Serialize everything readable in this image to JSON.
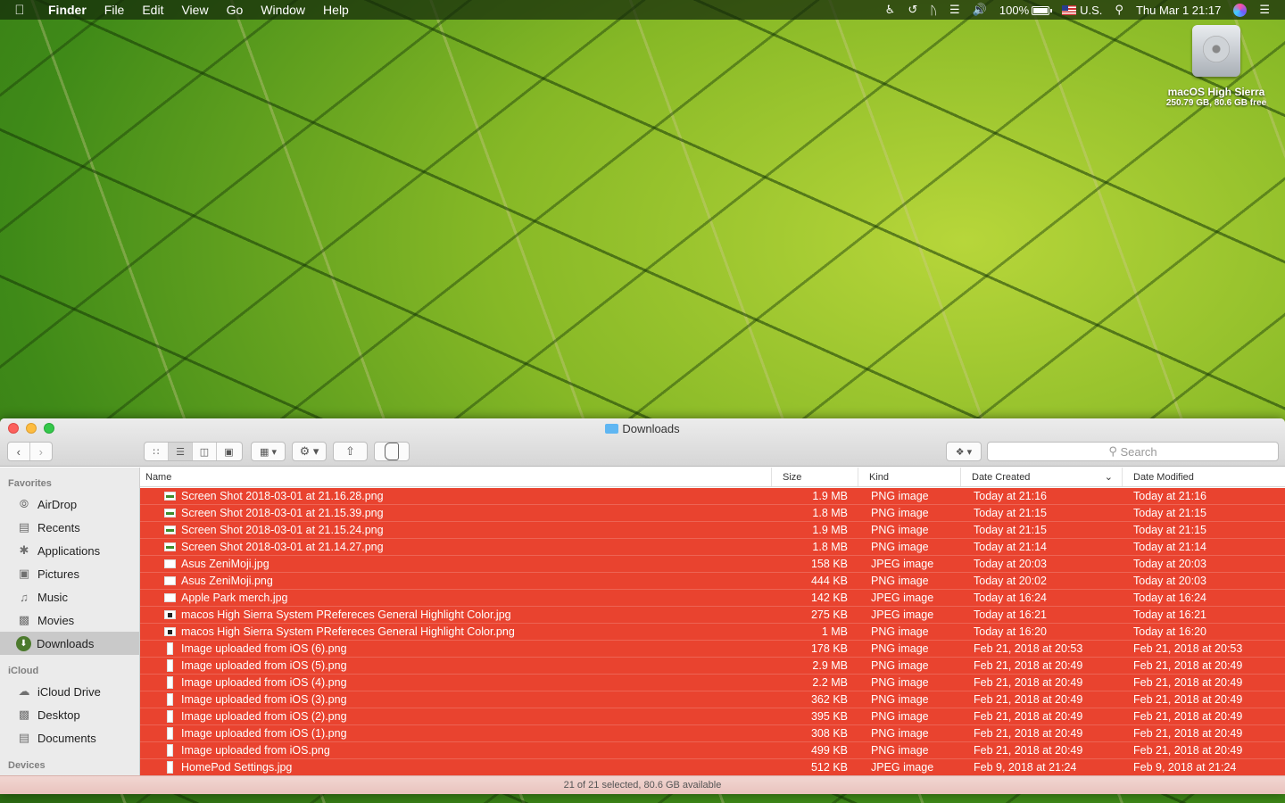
{
  "menubar": {
    "apple": "",
    "app_name": "Finder",
    "menus": [
      "File",
      "Edit",
      "View",
      "Go",
      "Window",
      "Help"
    ],
    "battery": "100%",
    "input_source": "U.S.",
    "datetime": "Thu Mar 1  21:17"
  },
  "desktop": {
    "drive_name": "macOS High Sierra",
    "drive_info": "250.79 GB, 80.6 GB free"
  },
  "window": {
    "title": "Downloads",
    "search_placeholder": "Search",
    "status": "21 of 21 selected, 80.6 GB available",
    "columns": {
      "name": "Name",
      "size": "Size",
      "kind": "Kind",
      "date_created": "Date Created",
      "date_modified": "Date Modified"
    }
  },
  "sidebar": {
    "favorites_title": "Favorites",
    "favorites": [
      {
        "label": "AirDrop",
        "icon": "airdrop-icon"
      },
      {
        "label": "Recents",
        "icon": "recents-icon"
      },
      {
        "label": "Applications",
        "icon": "applications-icon"
      },
      {
        "label": "Pictures",
        "icon": "pictures-icon"
      },
      {
        "label": "Music",
        "icon": "music-icon"
      },
      {
        "label": "Movies",
        "icon": "movies-icon"
      },
      {
        "label": "Downloads",
        "icon": "downloads-icon",
        "selected": true
      }
    ],
    "icloud_title": "iCloud",
    "icloud": [
      {
        "label": "iCloud Drive",
        "icon": "cloud-icon"
      },
      {
        "label": "Desktop",
        "icon": "desktop-icon"
      },
      {
        "label": "Documents",
        "icon": "documents-icon"
      }
    ],
    "devices_title": "Devices"
  },
  "files": [
    {
      "name": "Screen Shot 2018-03-01 at 21.16.28.png",
      "size": "1.9 MB",
      "kind": "PNG image",
      "created": "Today at 21:16",
      "modified": "Today at 21:16",
      "icon": "img"
    },
    {
      "name": "Screen Shot 2018-03-01 at 21.15.39.png",
      "size": "1.8 MB",
      "kind": "PNG image",
      "created": "Today at 21:15",
      "modified": "Today at 21:15",
      "icon": "img"
    },
    {
      "name": "Screen Shot 2018-03-01 at 21.15.24.png",
      "size": "1.9 MB",
      "kind": "PNG image",
      "created": "Today at 21:15",
      "modified": "Today at 21:15",
      "icon": "img"
    },
    {
      "name": "Screen Shot 2018-03-01 at 21.14.27.png",
      "size": "1.8 MB",
      "kind": "PNG image",
      "created": "Today at 21:14",
      "modified": "Today at 21:14",
      "icon": "img"
    },
    {
      "name": "Asus ZeniMoji.jpg",
      "size": "158 KB",
      "kind": "JPEG image",
      "created": "Today at 20:03",
      "modified": "Today at 20:03",
      "icon": "plain"
    },
    {
      "name": "Asus ZeniMoji.png",
      "size": "444 KB",
      "kind": "PNG image",
      "created": "Today at 20:02",
      "modified": "Today at 20:03",
      "icon": "plain"
    },
    {
      "name": "Apple Park merch.jpg",
      "size": "142 KB",
      "kind": "JPEG image",
      "created": "Today at 16:24",
      "modified": "Today at 16:24",
      "icon": "plain"
    },
    {
      "name": "macos High Sierra System PRefereces General Highlight Color.jpg",
      "size": "275 KB",
      "kind": "JPEG image",
      "created": "Today at 16:21",
      "modified": "Today at 16:21",
      "icon": "dark"
    },
    {
      "name": "macos High Sierra System PRefereces General Highlight Color.png",
      "size": "1 MB",
      "kind": "PNG image",
      "created": "Today at 16:20",
      "modified": "Today at 16:20",
      "icon": "dark"
    },
    {
      "name": "Image uploaded from iOS (6).png",
      "size": "178 KB",
      "kind": "PNG image",
      "created": "Feb 21, 2018 at 20:53",
      "modified": "Feb 21, 2018 at 20:53",
      "icon": "tall"
    },
    {
      "name": "Image uploaded from iOS (5).png",
      "size": "2.9 MB",
      "kind": "PNG image",
      "created": "Feb 21, 2018 at 20:49",
      "modified": "Feb 21, 2018 at 20:49",
      "icon": "tall"
    },
    {
      "name": "Image uploaded from iOS (4).png",
      "size": "2.2 MB",
      "kind": "PNG image",
      "created": "Feb 21, 2018 at 20:49",
      "modified": "Feb 21, 2018 at 20:49",
      "icon": "tall"
    },
    {
      "name": "Image uploaded from iOS (3).png",
      "size": "362 KB",
      "kind": "PNG image",
      "created": "Feb 21, 2018 at 20:49",
      "modified": "Feb 21, 2018 at 20:49",
      "icon": "tall"
    },
    {
      "name": "Image uploaded from iOS (2).png",
      "size": "395 KB",
      "kind": "PNG image",
      "created": "Feb 21, 2018 at 20:49",
      "modified": "Feb 21, 2018 at 20:49",
      "icon": "tall"
    },
    {
      "name": "Image uploaded from iOS (1).png",
      "size": "308 KB",
      "kind": "PNG image",
      "created": "Feb 21, 2018 at 20:49",
      "modified": "Feb 21, 2018 at 20:49",
      "icon": "tall"
    },
    {
      "name": "Image uploaded from iOS.png",
      "size": "499 KB",
      "kind": "PNG image",
      "created": "Feb 21, 2018 at 20:49",
      "modified": "Feb 21, 2018 at 20:49",
      "icon": "tall"
    },
    {
      "name": "HomePod Settings.jpg",
      "size": "512 KB",
      "kind": "JPEG image",
      "created": "Feb 9, 2018 at 21:24",
      "modified": "Feb 9, 2018 at 21:24",
      "icon": "tall"
    }
  ],
  "colors": {
    "selection": "#e9432f",
    "sidebar_bg": "#ebebeb"
  }
}
